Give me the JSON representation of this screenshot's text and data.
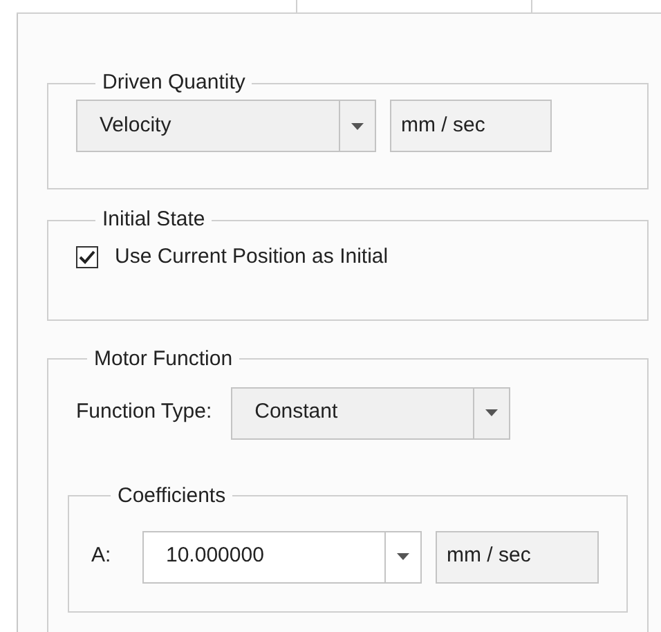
{
  "driven_quantity": {
    "title": "Driven Quantity",
    "dropdown": {
      "value": "Velocity"
    },
    "unit": "mm / sec"
  },
  "initial_state": {
    "title": "Initial State",
    "checkbox": {
      "label": "Use Current Position as Initial",
      "checked": true
    }
  },
  "motor_function": {
    "title": "Motor Function",
    "function_type": {
      "label": "Function Type:",
      "value": "Constant"
    },
    "coefficients": {
      "title": "Coefficients",
      "rows": [
        {
          "label": "A:",
          "value": "10.000000",
          "unit": "mm / sec"
        }
      ]
    }
  }
}
